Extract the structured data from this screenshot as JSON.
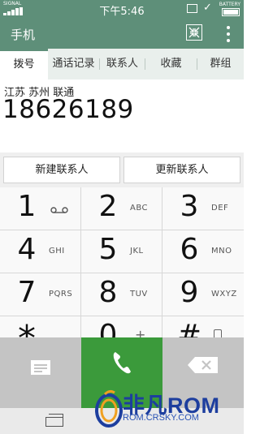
{
  "status_bar": {
    "signal_label": "SIGNAL",
    "time": "下午5:46",
    "battery_label": "BATTERY"
  },
  "app_bar": {
    "title": "手机",
    "icons": [
      "shrink-window-icon",
      "more-vert-icon"
    ]
  },
  "tabs": [
    {
      "label": "拨号",
      "active": true
    },
    {
      "label": "通话记录",
      "active": false
    },
    {
      "label": "联系人",
      "active": false
    },
    {
      "label": "收藏",
      "active": false
    },
    {
      "label": "群组",
      "active": false
    }
  ],
  "dialer": {
    "location": "江苏 苏州 联通",
    "number": "18626189"
  },
  "contact_actions": {
    "new_contact": "新建联系人",
    "update_contact": "更新联系人"
  },
  "keys": [
    {
      "digit": "1",
      "letters": "",
      "extra": "voicemail-icon"
    },
    {
      "digit": "2",
      "letters": "ABC"
    },
    {
      "digit": "3",
      "letters": "DEF"
    },
    {
      "digit": "4",
      "letters": "GHI"
    },
    {
      "digit": "5",
      "letters": "JKL"
    },
    {
      "digit": "6",
      "letters": "MNO"
    },
    {
      "digit": "7",
      "letters": "PQRS"
    },
    {
      "digit": "8",
      "letters": "TUV"
    },
    {
      "digit": "9",
      "letters": "WXYZ"
    },
    {
      "digit": "*",
      "letters": ""
    },
    {
      "digit": "0",
      "letters": "+"
    },
    {
      "digit": "#",
      "letters": "",
      "extra": "phone-small-icon"
    }
  ],
  "bottom_bar": {
    "icons": [
      "sms-icon",
      "call-icon",
      "backspace-icon"
    ],
    "call_color": "#3b9a3b"
  },
  "watermark": {
    "brand": "非凡ROM",
    "url": "ROM.CRSKY.COM"
  },
  "colors": {
    "accent": "#5e8f79"
  }
}
